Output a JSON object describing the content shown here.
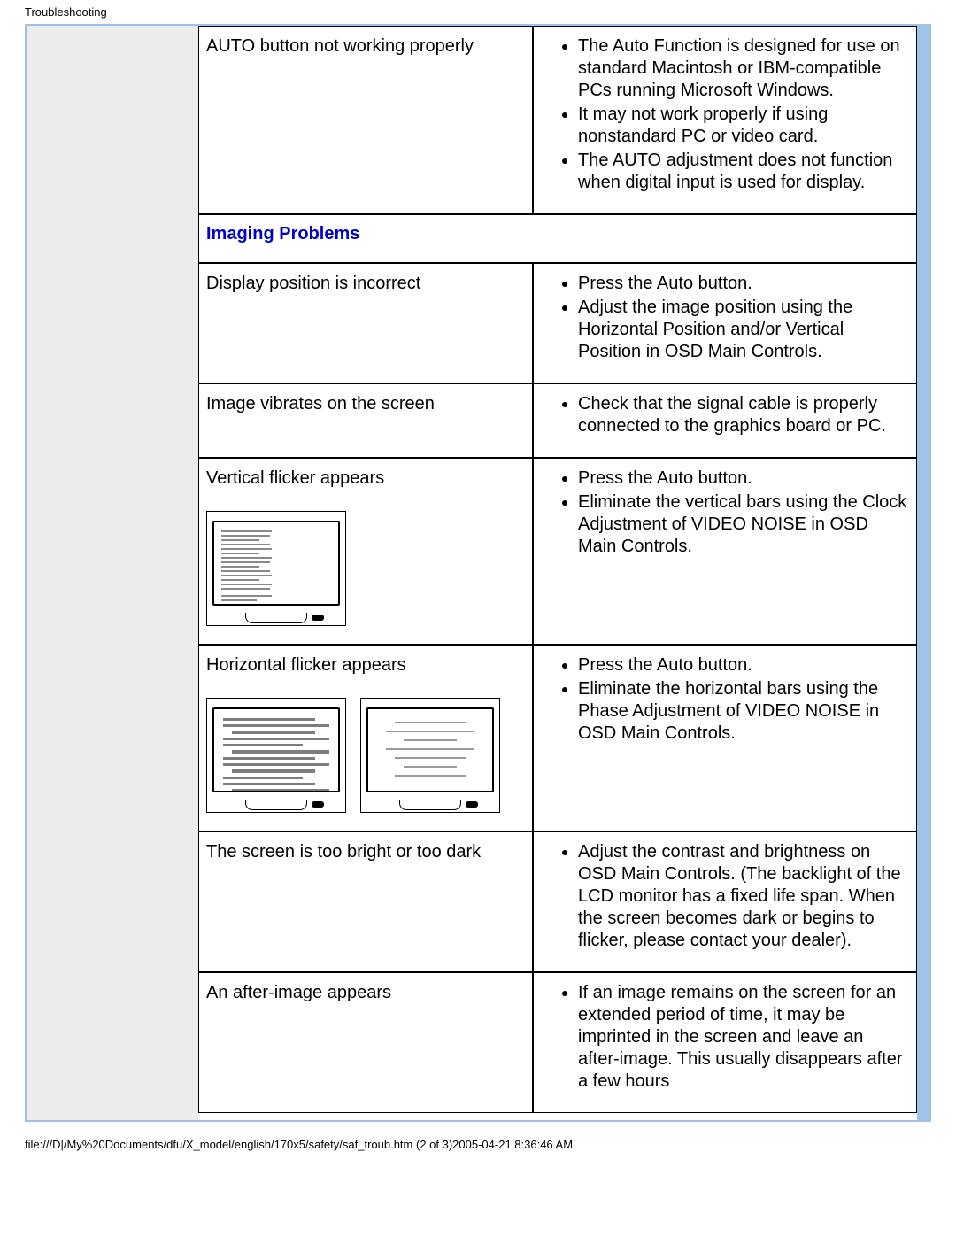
{
  "header": {
    "title": "Troubleshooting"
  },
  "rows": {
    "auto": {
      "label": "AUTO button not working properly",
      "items": [
        "The Auto Function is designed for use on standard Macintosh or IBM-compatible PCs running Microsoft Windows.",
        "It may not work properly if using nonstandard PC or video card.",
        "The AUTO adjustment does not function when digital input is used for display."
      ]
    },
    "section": {
      "title": "Imaging Problems"
    },
    "pos": {
      "label": "Display position is incorrect",
      "items": [
        "Press the Auto button.",
        "Adjust the image position using the Horizontal Position and/or Vertical Position in OSD Main Controls."
      ]
    },
    "vibr": {
      "label": "Image vibrates on the screen",
      "items": [
        "Check that the signal cable is properly connected to the graphics board or PC."
      ]
    },
    "vflick": {
      "label": "Vertical flicker appears",
      "items": [
        "Press the Auto button.",
        "Eliminate the vertical bars using the Clock Adjustment of VIDEO NOISE in OSD Main Controls."
      ]
    },
    "hflick": {
      "label": "Horizontal flicker appears",
      "items": [
        "Press the Auto button.",
        "Eliminate the horizontal bars using the Phase Adjustment of VIDEO NOISE in OSD Main Controls."
      ]
    },
    "bright": {
      "label": "The screen is too bright or too dark",
      "items": [
        "Adjust the contrast and brightness on OSD Main Controls. (The backlight of the LCD monitor has a fixed life span. When the screen becomes dark or begins to flicker, please contact your dealer)."
      ]
    },
    "after": {
      "label": "An after-image appears",
      "items": [
        "If an image remains on the screen for an extended period of time, it may be imprinted in the screen and leave an after-image. This usually disappears after a few hours"
      ]
    }
  },
  "footer": {
    "text": "file:///D|/My%20Documents/dfu/X_model/english/170x5/safety/saf_troub.htm (2 of 3)2005-04-21 8:36:46 AM"
  }
}
